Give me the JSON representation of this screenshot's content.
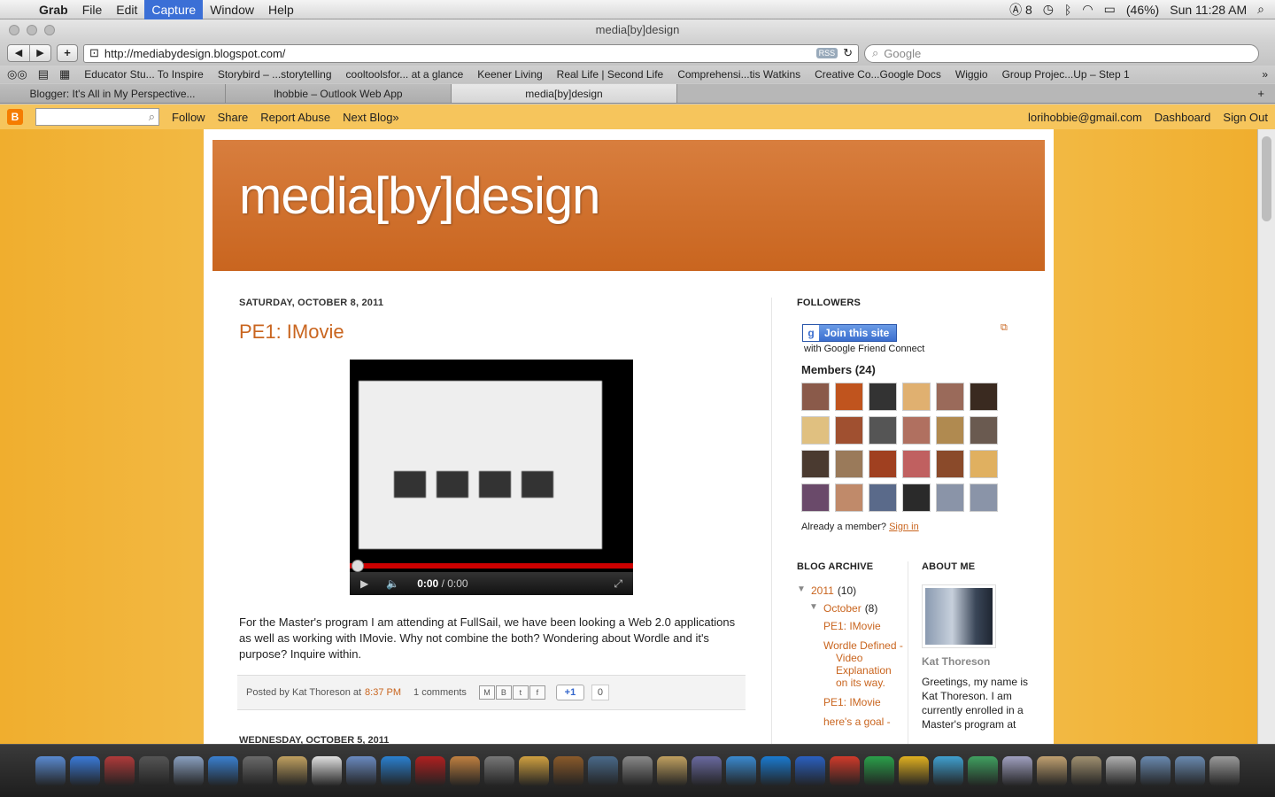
{
  "menubar": {
    "app": "Grab",
    "items": [
      "File",
      "Edit",
      "Capture",
      "Window",
      "Help"
    ],
    "active": "Capture",
    "status": {
      "adobe_count": "8",
      "battery": "(46%)",
      "clock": "Sun 11:28 AM"
    }
  },
  "window": {
    "title": "media[by]design"
  },
  "toolbar": {
    "url": "http://mediabydesign.blogspot.com/",
    "rss": "RSS",
    "search_placeholder": "Google"
  },
  "bookmarks": [
    "Educator Stu... To Inspire",
    "Storybird – ...storytelling",
    "cooltoolsfor... at a glance",
    "Keener Living",
    "Real Life | Second Life",
    "Comprehensi...tis Watkins",
    "Creative Co...Google Docs",
    "Wiggio",
    "Group Projec...Up – Step 1"
  ],
  "tabs": [
    {
      "label": "Blogger: It's All in My Perspective..."
    },
    {
      "label": "lhobbie – Outlook Web App"
    },
    {
      "label": "media[by]design"
    }
  ],
  "blogger_nav": {
    "links": [
      "Follow",
      "Share",
      "Report Abuse",
      "Next Blog»"
    ],
    "user": "lorihobbie@gmail.com",
    "dashboard": "Dashboard",
    "signout": "Sign Out"
  },
  "blog": {
    "title": "media[by]design"
  },
  "post": {
    "date": "SATURDAY, OCTOBER 8, 2011",
    "title": "PE1: IMovie",
    "video_time": "0:00",
    "video_duration": "/ 0:00",
    "body": "For the Master's program I am attending at FullSail, we have been looking a Web 2.0 applications as well as working with IMovie. Why not combine the both? Wondering about Wordle and it's purpose? Inquire within.",
    "posted_by_prefix": "Posted by Kat Thoreson at",
    "posted_time": "8:37 PM",
    "comments": "1 comments",
    "plus_one": "+1",
    "plus_count": "0",
    "next_date": "WEDNESDAY, OCTOBER 5, 2011"
  },
  "followers": {
    "title": "FOLLOWERS",
    "join_label": "Join this site",
    "with_label": "with Google Friend Connect",
    "members_label": "Members (24)",
    "already_label": "Already a member?",
    "signin_label": "Sign in",
    "avatar_colors": [
      "#8a5a4a",
      "#c0541e",
      "#333333",
      "#e0b070",
      "#9a6a5a",
      "#3a2a20",
      "#e0c080",
      "#a05030",
      "#555555",
      "#b07060",
      "#b08a50",
      "#6a5a50",
      "#4a3a30",
      "#9a7a5a",
      "#a04020",
      "#c06060",
      "#8a4a2a",
      "#e0b060",
      "#6a4a6a",
      "#c08a6a",
      "#5a6a8a",
      "#2a2a2a",
      "#8a94a8",
      "#8a94a8"
    ]
  },
  "archive": {
    "title": "BLOG ARCHIVE",
    "year": "2011",
    "year_count": "(10)",
    "month": "October",
    "month_count": "(8)",
    "posts": [
      "PE1: IMovie",
      "Wordle Defined - Video Explanation on its way.",
      "PE1: IMovie",
      "here's a goal -"
    ]
  },
  "about": {
    "title": "ABOUT ME",
    "name": "Kat Thoreson",
    "bio": "Greetings, my name is Kat Thoreson. I am currently enrolled in a Master's program at"
  },
  "dock_colors": [
    "#5a8ad0",
    "#3a7ad8",
    "#b03a3a",
    "#555555",
    "#8aa0c0",
    "#3a80d0",
    "#6a6a6a",
    "#c0a060",
    "#e0e0e0",
    "#6a8ac0",
    "#2a80d0",
    "#b02020",
    "#c08040",
    "#777777",
    "#d0a040",
    "#8a5a2a",
    "#4a6a8a",
    "#888888",
    "#c0a060",
    "#6a6aa0",
    "#3a8ad0",
    "#1a7ad0",
    "#2a60c0",
    "#d03a2a",
    "#2aa04a",
    "#e0b020",
    "#40a0d0",
    "#40a060",
    "#a0a0c0",
    "#c0a070",
    "#a09070",
    "#b0b0b0",
    "#6a8ab0",
    "#6a8ab0",
    "#9a9a9a"
  ]
}
